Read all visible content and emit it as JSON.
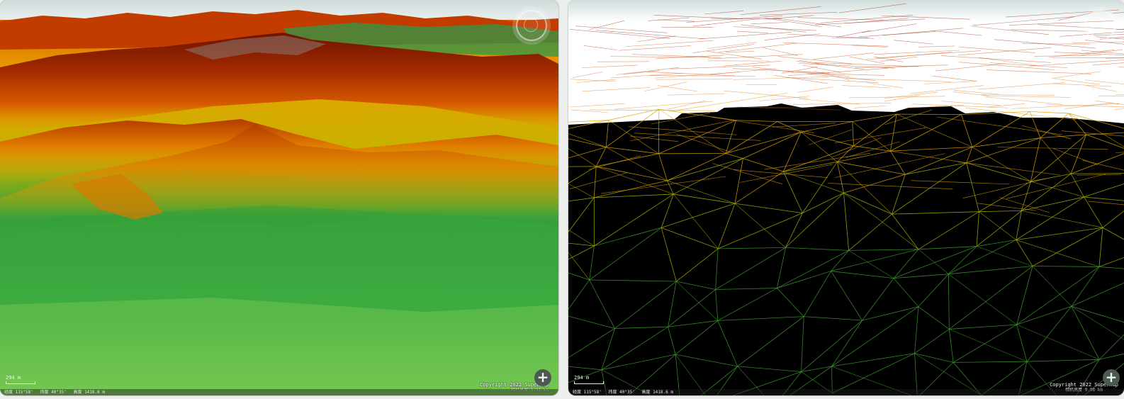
{
  "left_viewer": {
    "mode": "terrain-shaded",
    "scale_label": "294 m",
    "copyright": "Copyright 2022 SuperMap",
    "camera_height": "相机高度 9.98 km",
    "status_items": [
      "经度 115°58'",
      "纬度 40°35'",
      "高度 1418.6 m"
    ],
    "zoom_icon": "plus-circle-icon",
    "compass_icon": "compass-icon"
  },
  "right_viewer": {
    "mode": "terrain-wireframe",
    "scale_label": "294 m",
    "copyright": "Copyright 2022 SuperMap",
    "camera_height": "相机高度 9.98 km",
    "status_items": [
      "经度 115°58'",
      "纬度 40°35'",
      "高度 1418.6 m"
    ],
    "zoom_icon": "plus-circle-icon",
    "compass_icon": "compass-icon"
  },
  "colors": {
    "high": "#7a1500",
    "mid_high": "#d45a00",
    "mid": "#e8b000",
    "low": "#1e9a3a",
    "lowest": "#7ccc52",
    "sky": "#dfe8e6",
    "wire_bg": "#000000"
  }
}
